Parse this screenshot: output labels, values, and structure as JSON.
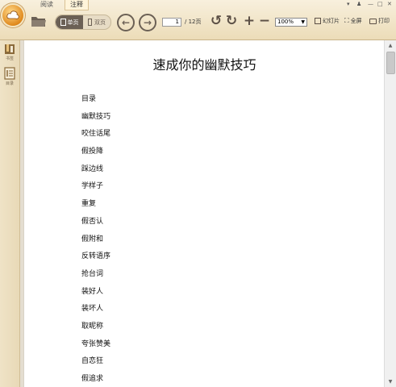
{
  "toolbar": {
    "tabs": [
      {
        "label": "阅读"
      },
      {
        "label": "注释"
      }
    ],
    "view_modes": {
      "single": "单页",
      "double": "双页"
    },
    "page_current": "1",
    "page_total": "/ 12页",
    "zoom": "100%",
    "slideshow": "幻灯片",
    "fullscreen": "全屏",
    "print": "打印"
  },
  "sidebar": {
    "bookmarks": "书签",
    "toc": "目录"
  },
  "document": {
    "title": "速成你的幽默技巧",
    "toc_items": [
      "目录",
      "幽默技巧",
      "咬住话尾",
      "假投降",
      "踩边线",
      "学样子",
      "重复",
      "假否认",
      "假附和",
      "反转语序",
      "抢台词",
      "装好人",
      "装坏人",
      "取昵称",
      "夸张赞美",
      "自恋狂",
      "假追求"
    ]
  }
}
